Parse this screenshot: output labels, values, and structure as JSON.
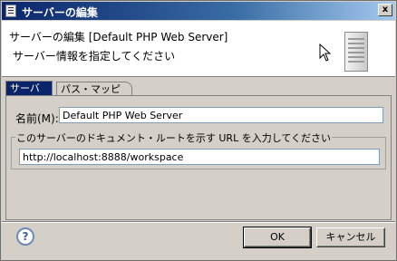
{
  "window": {
    "title": "サーバーの編集",
    "close_glyph": "x"
  },
  "header": {
    "title": "サーバーの編集 [Default PHP Web Server]",
    "description": "サーバー情報を指定してください"
  },
  "tabs": [
    {
      "label": "サーバー",
      "active": true
    },
    {
      "label": "パス・マッピング",
      "active": false
    }
  ],
  "form": {
    "name_label": "名前(M):",
    "name_value": "Default PHP Web Server",
    "url_group_label": "このサーバーのドキュメント・ルートを示す URL を入力してください",
    "url_value": "http://localhost:8888/workspace"
  },
  "buttons": {
    "help_glyph": "?",
    "ok": "OK",
    "cancel": "キャンセル"
  }
}
